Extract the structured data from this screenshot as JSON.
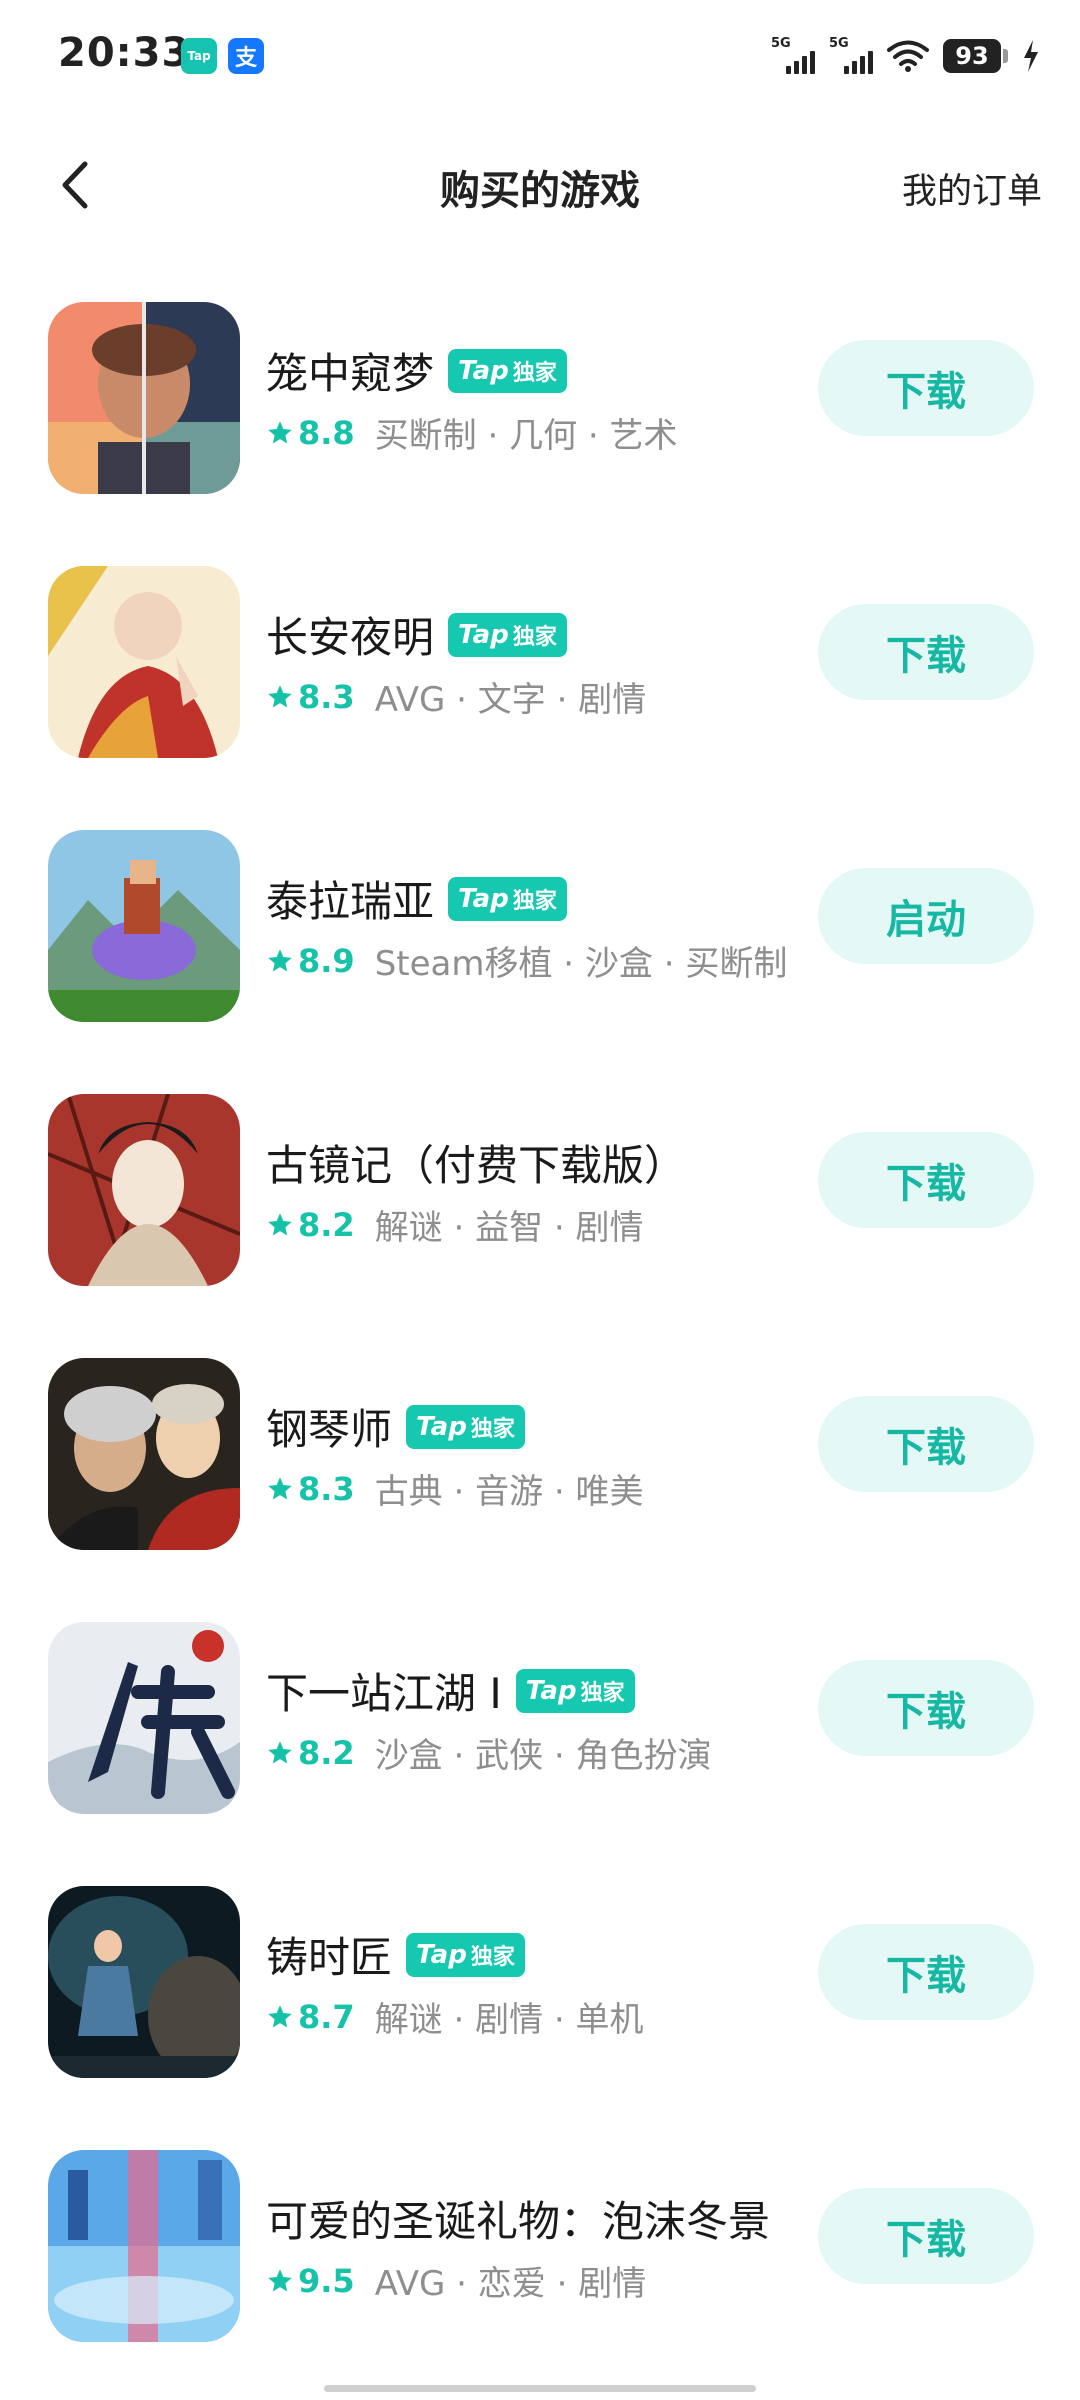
{
  "status_bar": {
    "time": "20:33",
    "notifications": [
      {
        "icon": "taptap-icon",
        "label": "Tap"
      },
      {
        "icon": "alipay-icon",
        "label": "支"
      }
    ],
    "signal_1": "5G",
    "signal_2": "5G",
    "battery": "93"
  },
  "header": {
    "title": "购买的游戏",
    "orders_link": "我的订单"
  },
  "badge": {
    "tap": "Tap",
    "exclusive": "独家"
  },
  "accent_color": "#16c2a8",
  "games": [
    {
      "name": "笼中窥梦",
      "exclusive": true,
      "rating": "8.8",
      "tags": "买断制 · 几何 · 艺术",
      "action": "下载"
    },
    {
      "name": "长安夜明",
      "exclusive": true,
      "rating": "8.3",
      "tags": "AVG · 文字 · 剧情",
      "action": "下载"
    },
    {
      "name": "泰拉瑞亚",
      "exclusive": true,
      "rating": "8.9",
      "tags": "Steam移植 · 沙盒 · 买断制",
      "action": "启动"
    },
    {
      "name": "古镜记（付费下载版）",
      "exclusive": false,
      "rating": "8.2",
      "tags": "解谜 · 益智 · 剧情",
      "action": "下载"
    },
    {
      "name": "钢琴师",
      "exclusive": true,
      "rating": "8.3",
      "tags": "古典 · 音游 · 唯美",
      "action": "下载"
    },
    {
      "name": "下一站江湖 Ⅰ",
      "exclusive": true,
      "rating": "8.2",
      "tags": "沙盒 · 武侠 · 角色扮演",
      "action": "下载"
    },
    {
      "name": "铸时匠",
      "exclusive": true,
      "rating": "8.7",
      "tags": "解谜 · 剧情 · 单机",
      "action": "下载"
    },
    {
      "name": "可爱的圣诞礼物：泡沫冬景",
      "exclusive": false,
      "rating": "9.5",
      "tags": "AVG · 恋爱 · 剧情",
      "action": "下载"
    }
  ]
}
